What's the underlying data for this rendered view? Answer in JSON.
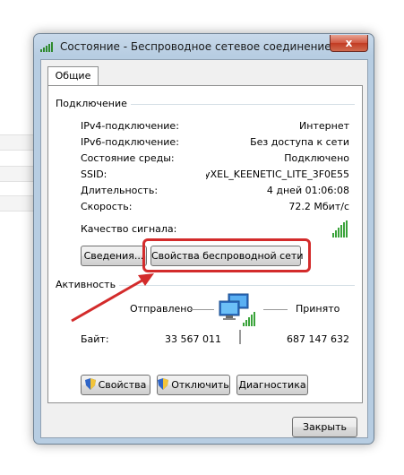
{
  "window": {
    "title": "Состояние - Беспроводное сетевое соединение",
    "close_glyph": "x"
  },
  "tabs": [
    {
      "label": "Общие"
    }
  ],
  "connection": {
    "group_label": "Подключение",
    "rows": [
      {
        "label": "IPv4-подключение:",
        "value": "Интернет"
      },
      {
        "label": "IPv6-подключение:",
        "value": "Без доступа к сети"
      },
      {
        "label": "Состояние среды:",
        "value": "Подключено"
      },
      {
        "label": "SSID:",
        "value": "ZyXEL_KEENETIC_LITE_3F0E55"
      },
      {
        "label": "Длительность:",
        "value": "4 дней 01:06:08"
      },
      {
        "label": "Скорость:",
        "value": "72.2 Мбит/с"
      }
    ],
    "signal_quality_label": "Качество сигнала:"
  },
  "buttons": {
    "details": "Сведения...",
    "wireless_properties": "Свойства беспроводной сети",
    "properties": "Свойства",
    "disconnect": "Отключить",
    "diagnostics": "Диагностика",
    "close": "Закрыть"
  },
  "activity": {
    "group_label": "Активность",
    "sent_label": "Отправлено",
    "received_label": "Принято",
    "bytes_label": "Байт:",
    "bytes_sent": "33 567 011",
    "bytes_received": "687 147 632"
  },
  "colors": {
    "highlight": "#d32b2b",
    "signal": "#3aa33a"
  }
}
